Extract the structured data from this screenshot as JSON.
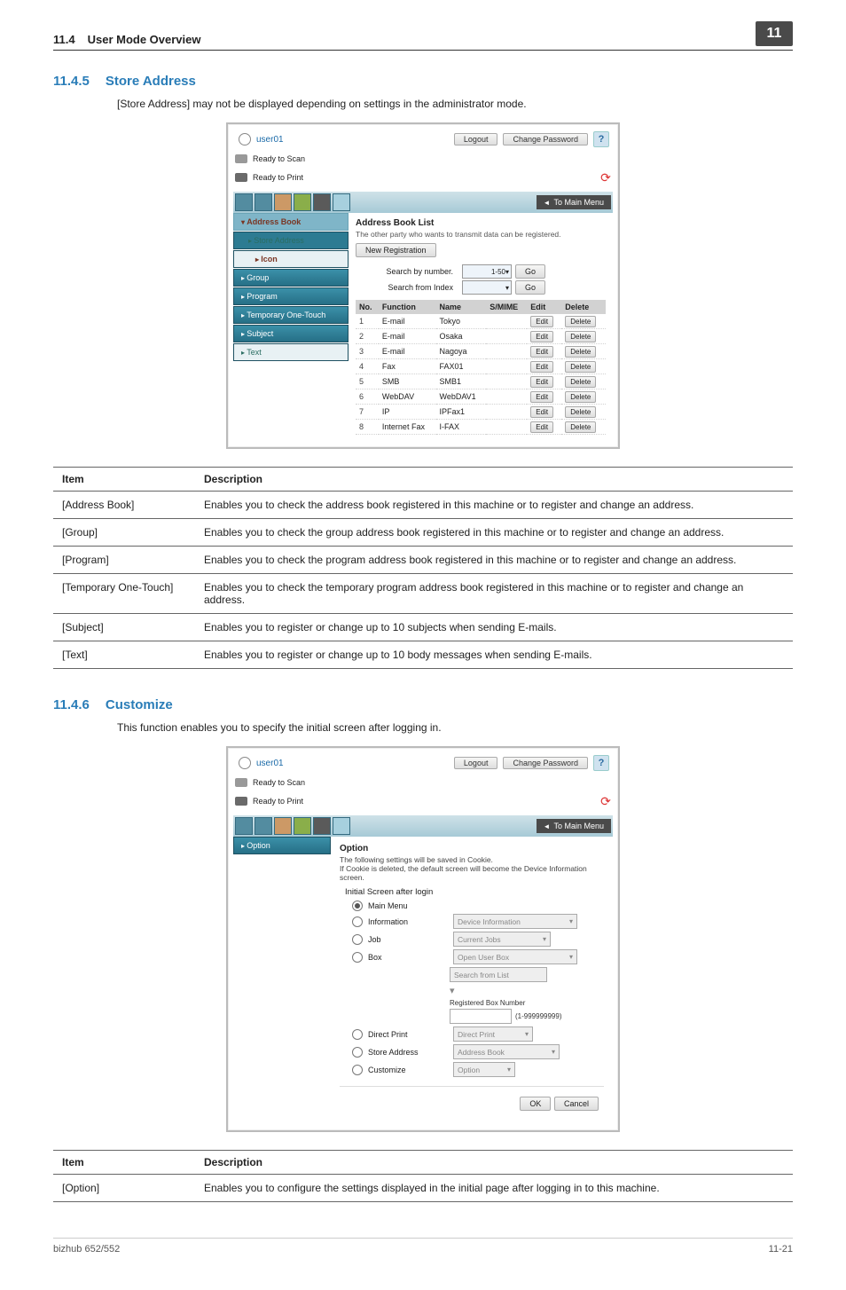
{
  "page_header": {
    "section_no": "11.4",
    "section_title": "User Mode Overview",
    "badge": "11"
  },
  "s1": {
    "num": "11.4.5",
    "title": "Store Address",
    "lead": "[Store Address] may not be displayed depending on settings in the administrator mode."
  },
  "app": {
    "user": "user01",
    "btn_logout": "Logout",
    "btn_changepw": "Change Password",
    "status_scan": "Ready to Scan",
    "status_print": "Ready to Print",
    "to_main": "To Main Menu"
  },
  "nav1": {
    "address_book": "Address Book",
    "store_address": "Store Address",
    "icon": "Icon",
    "group": "Group",
    "program": "Program",
    "temp": "Temporary One-Touch",
    "subject": "Subject",
    "text": "Text"
  },
  "panel1": {
    "heading": "Address Book List",
    "note": "The other party who wants to transmit data can be registered.",
    "btn_newreg": "New Registration",
    "search_number": "Search by number.",
    "search_index": "Search from Index",
    "range": "1-50",
    "go": "Go",
    "cols": {
      "no": "No.",
      "func": "Function",
      "name": "Name",
      "smime": "S/MIME",
      "edit": "Edit",
      "del": "Delete"
    },
    "btn_edit": "Edit",
    "btn_del": "Delete",
    "rows": [
      {
        "no": "1",
        "func": "E-mail",
        "name": "Tokyo"
      },
      {
        "no": "2",
        "func": "E-mail",
        "name": "Osaka"
      },
      {
        "no": "3",
        "func": "E-mail",
        "name": "Nagoya"
      },
      {
        "no": "4",
        "func": "Fax",
        "name": "FAX01"
      },
      {
        "no": "5",
        "func": "SMB",
        "name": "SMB1"
      },
      {
        "no": "6",
        "func": "WebDAV",
        "name": "WebDAV1"
      },
      {
        "no": "7",
        "func": "IP",
        "name": "IPFax1"
      },
      {
        "no": "8",
        "func": "Internet Fax",
        "name": "I-FAX"
      }
    ]
  },
  "desc1": {
    "hd_item": "Item",
    "hd_desc": "Description",
    "rows": [
      {
        "it": "[Address Book]",
        "dd": "Enables you to check the address book registered in this machine or to register and change an address."
      },
      {
        "it": "[Group]",
        "dd": "Enables you to check the group address book registered in this machine or to register and change an address."
      },
      {
        "it": "[Program]",
        "dd": "Enables you to check the program address book registered in this machine or to register and change an address."
      },
      {
        "it": "[Temporary One-Touch]",
        "dd": "Enables you to check the temporary program address book registered in this machine or to register and change an address."
      },
      {
        "it": "[Subject]",
        "dd": "Enables you to register or change up to 10 subjects when sending E-mails."
      },
      {
        "it": "[Text]",
        "dd": "Enables you to register or change up to 10 body messages when sending E-mails."
      }
    ]
  },
  "s2": {
    "num": "11.4.6",
    "title": "Customize",
    "lead": "This function enables you to specify the initial screen after logging in."
  },
  "nav2": {
    "option": "Option"
  },
  "panel2": {
    "heading": "Option",
    "note1": "The following settings will be saved in Cookie.",
    "note2": "If Cookie is deleted, the default screen will become the Device Information screen.",
    "subhead": "Initial Screen after login",
    "opts": {
      "main": "Main Menu",
      "info": "Information",
      "info_sel": "Device Information",
      "job": "Job",
      "job_sel": "Current Jobs",
      "box": "Box",
      "box_sel": "Open User Box",
      "box_search": "Search from List",
      "regbox_lbl": "Registered Box Number",
      "regbox_range": "(1-999999999)",
      "direct": "Direct Print",
      "direct_sel": "Direct Print",
      "store": "Store Address",
      "store_sel": "Address Book",
      "cust": "Customize",
      "cust_sel": "Option"
    },
    "ok": "OK",
    "cancel": "Cancel"
  },
  "desc2": {
    "hd_item": "Item",
    "hd_desc": "Description",
    "rows": [
      {
        "it": "[Option]",
        "dd": "Enables you to configure the settings displayed in the initial page after logging in to this machine."
      }
    ]
  },
  "footer": {
    "left": "bizhub 652/552",
    "right": "11-21"
  }
}
